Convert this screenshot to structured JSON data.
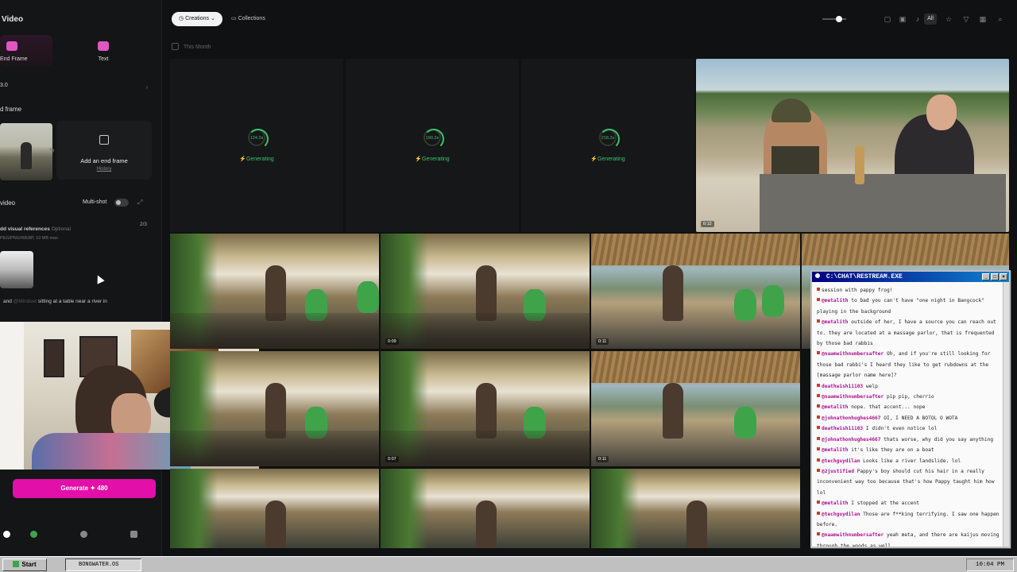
{
  "left_panel": {
    "title": "Video",
    "tabs": [
      {
        "label": "End Frame",
        "active": true
      },
      {
        "label": "Text",
        "active": false
      }
    ],
    "model": "3.0",
    "end_frame_section": "d frame",
    "add_end_frame": "Add an end frame",
    "history": "History",
    "video_section": "video",
    "multishot": "Multi-shot",
    "visual_refs_label": "dd visual references",
    "visual_refs_optional": "Optional",
    "visual_refs_sub": "PEG/PNG/WEBP, 10 MB max",
    "refs_count": "2/3",
    "prompt_and": "and",
    "prompt_mention": "@Mindset",
    "prompt_rest": "sitting at a table near a river in",
    "generate_label": "Generate",
    "generate_cost": "480"
  },
  "topbar": {
    "creations": "Creations",
    "collections": "Collections",
    "filter_all": "All"
  },
  "month_label": "This Month",
  "generating": [
    {
      "secs": "124.2s",
      "status": "Generating"
    },
    {
      "secs": "190.2s",
      "status": "Generating"
    },
    {
      "secs": "218.2s",
      "status": "Generating"
    }
  ],
  "video_durations": {
    "hero": "0:12",
    "row1": [
      "0:09",
      "0:11"
    ],
    "row2": [
      "0:07",
      "0:11"
    ]
  },
  "chat": {
    "title": "C:\\CHAT\\RESTREAM.EXE",
    "messages": [
      {
        "user": "",
        "text": "session with pappy frog!"
      },
      {
        "user": "@metalith",
        "text": "to bad you can't have \"one night in Bangcock\" playing in the background"
      },
      {
        "user": "@metalith",
        "text": "outside of her, I have a source you can reach out to. they are located at a massage parlor, that is frequented by those bad rabbis"
      },
      {
        "user": "@naamwithnumbersafter",
        "text": "Oh, and if you're still looking for those bad rabbi's I heard they like to get rubdowns at the [massage parlor name here]?"
      },
      {
        "user": "deathwish11103",
        "text": "welp"
      },
      {
        "user": "@naamwithnumbersafter",
        "text": "pip pip, cherrio"
      },
      {
        "user": "@metalith",
        "text": "nope. that accent... nope"
      },
      {
        "user": "@johnathonhughes4667",
        "text": "OI, I NEED A BOTOL O WOTA"
      },
      {
        "user": "deathwish11103",
        "text": "I didn't even notice lol"
      },
      {
        "user": "@johnathonhughes4667",
        "text": "thats worse, why did you say anything"
      },
      {
        "user": "@metalith",
        "text": "it's like they are on a boat"
      },
      {
        "user": "@techguydilan",
        "text": "Looks like a river landslide. lol"
      },
      {
        "user": "@2justified",
        "text": "Pappy's boy should cut his hair in a really inconvenient way too because that's how Pappy taught him how lol"
      },
      {
        "user": "@metalith",
        "text": "I stopped at the accent"
      },
      {
        "user": "@techguydilan",
        "text": "Those are f**king terrifying. I saw one happen before."
      },
      {
        "user": "@naamwithnumbersafter",
        "text": "yeah meta, and there are kaijus moving through the woods as well"
      }
    ]
  },
  "taskbar": {
    "start": "Start",
    "task": "BONGWATER.OS",
    "clock": "10:04 PM"
  },
  "icons": [
    "image-icon",
    "text-icon",
    "clock-icon",
    "folder-icon",
    "star-icon",
    "filter-icon",
    "grid-icon",
    "search-icon",
    "expand-icon",
    "swap-icon"
  ],
  "colors": {
    "accent": "#e30fa9",
    "generating": "#3ec26a",
    "title_bar": "#000080"
  }
}
